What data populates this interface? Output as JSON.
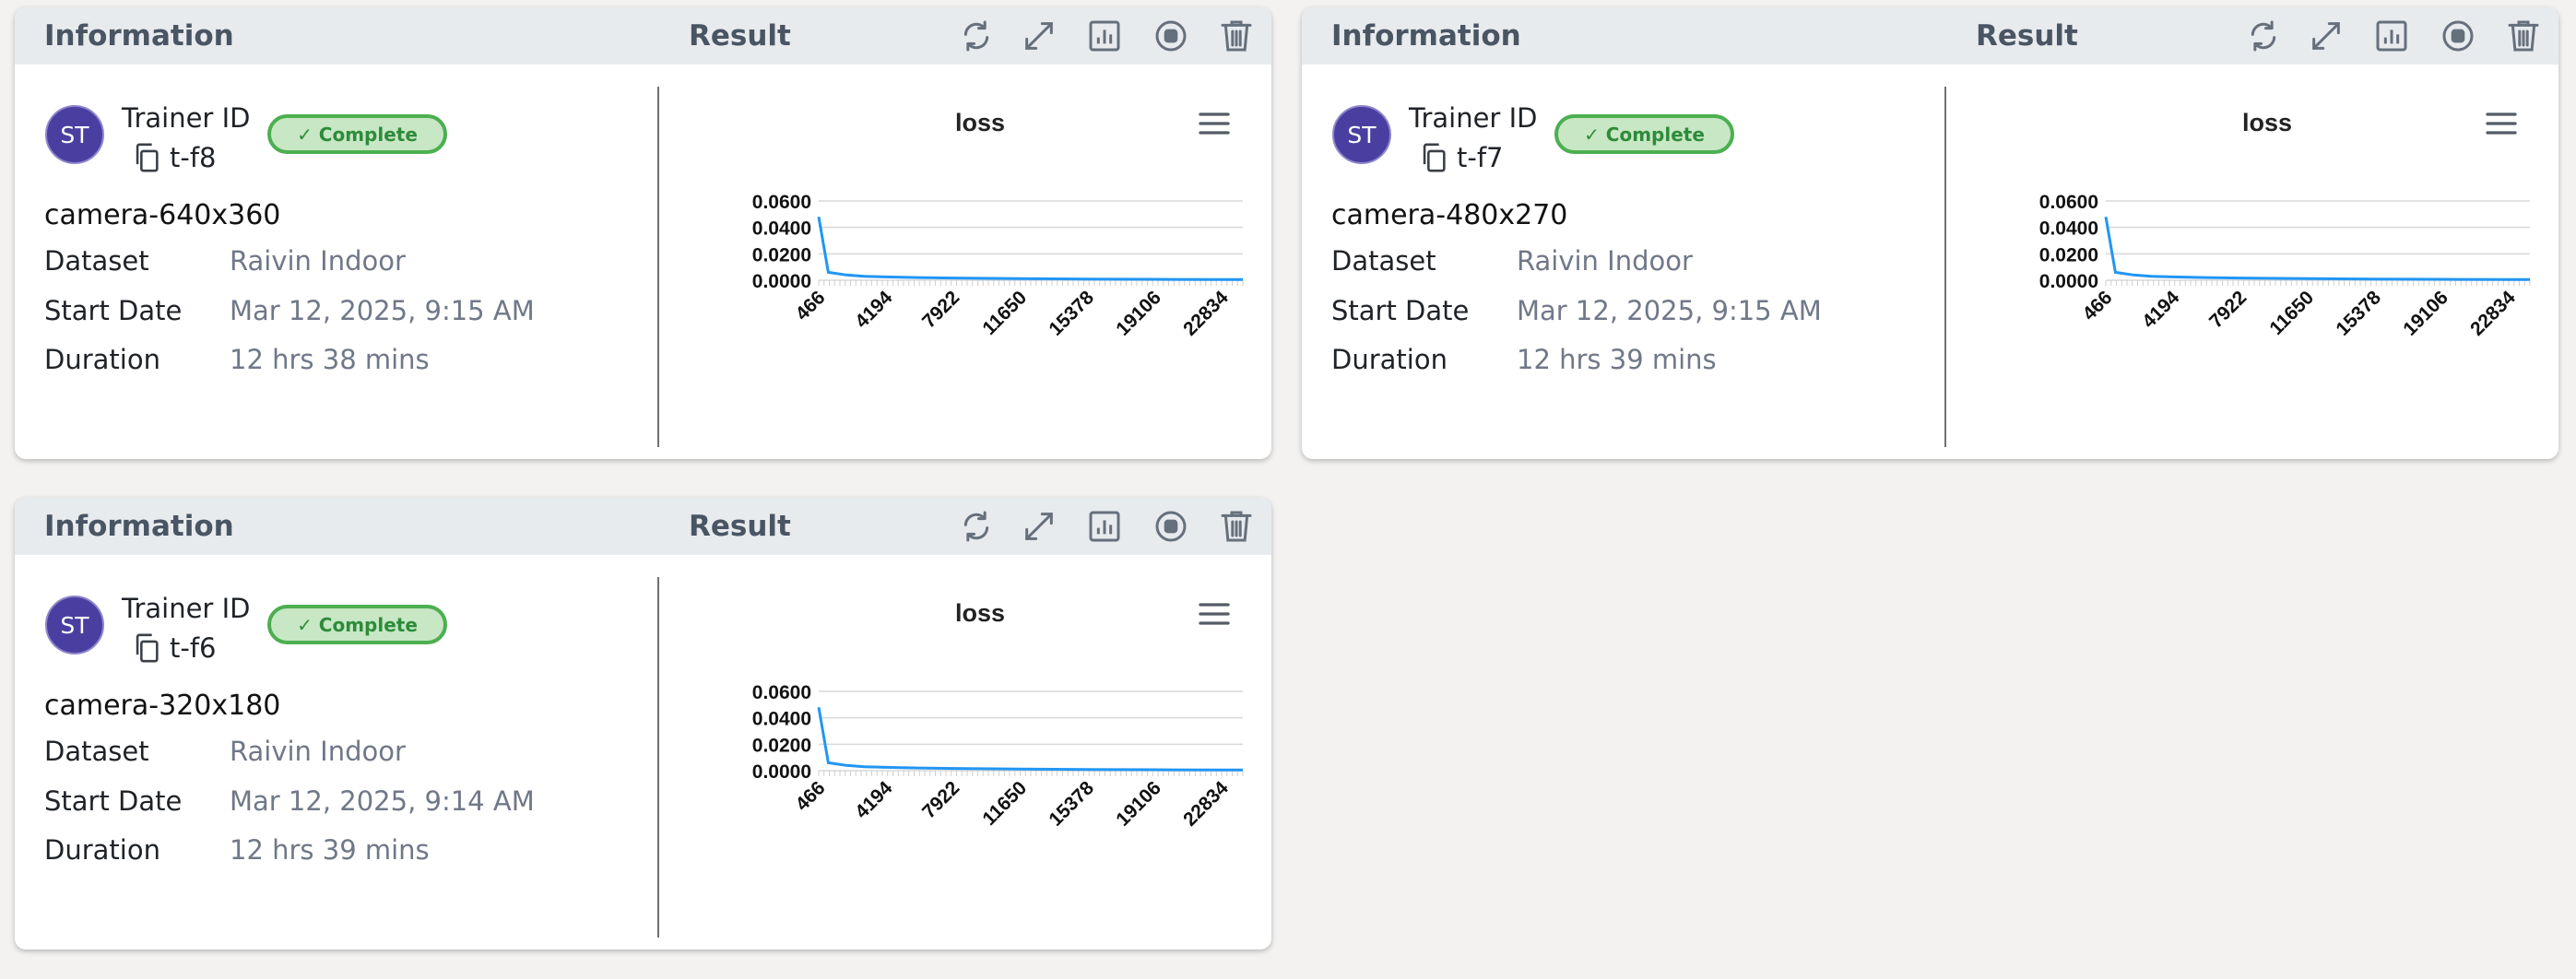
{
  "cards": [
    {
      "header": {
        "info": "Information",
        "result": "Result"
      },
      "avatar": "ST",
      "trainer_label": "Trainer ID",
      "trainer_id": "t-f8",
      "status": "✓ Complete",
      "model": "camera-640x360",
      "rows": [
        {
          "label": "Dataset",
          "value": "Raivin Indoor"
        },
        {
          "label": "Start Date",
          "value": "Mar 12, 2025, 9:15 AM"
        },
        {
          "label": "Duration",
          "value": "12 hrs 38 mins"
        }
      ]
    },
    {
      "header": {
        "info": "Information",
        "result": "Result"
      },
      "avatar": "ST",
      "trainer_label": "Trainer ID",
      "trainer_id": "t-f7",
      "status": "✓ Complete",
      "model": "camera-480x270",
      "rows": [
        {
          "label": "Dataset",
          "value": "Raivin Indoor"
        },
        {
          "label": "Start Date",
          "value": "Mar 12, 2025, 9:15 AM"
        },
        {
          "label": "Duration",
          "value": "12 hrs 39 mins"
        }
      ]
    },
    {
      "header": {
        "info": "Information",
        "result": "Result"
      },
      "avatar": "ST",
      "trainer_label": "Trainer ID",
      "trainer_id": "t-f6",
      "status": "✓ Complete",
      "model": "camera-320x180",
      "rows": [
        {
          "label": "Dataset",
          "value": "Raivin Indoor"
        },
        {
          "label": "Start Date",
          "value": "Mar 12, 2025, 9:14 AM"
        },
        {
          "label": "Duration",
          "value": "12 hrs 39 mins"
        }
      ]
    }
  ],
  "icons": {
    "toolbar": [
      "refresh-icon",
      "expand-icon",
      "chart-icon",
      "stop-icon",
      "delete-icon"
    ],
    "copy": "copy-icon",
    "menu": "menu-icon"
  },
  "colors": {
    "header_bg": "#e8ebee",
    "avatar": "#4a3fa0",
    "badge_border": "#4caf50",
    "badge_bg": "#c7e7c5",
    "line": "#2196f3"
  },
  "chart_data": [
    {
      "type": "line",
      "title": "loss",
      "xlabel": "",
      "ylabel": "",
      "y_ticks": [
        "0.0000",
        "0.0200",
        "0.0400",
        "0.0600"
      ],
      "ylim": [
        0,
        0.06
      ],
      "x_ticks": [
        "466",
        "4194",
        "7922",
        "11650",
        "15378",
        "19106",
        "22834"
      ],
      "xlim": [
        466,
        24000
      ],
      "series": [
        {
          "x": [
            466,
            1000,
            2000,
            3000,
            4194,
            6000,
            7922,
            11650,
            15378,
            19106,
            22834,
            24000
          ],
          "values": [
            0.048,
            0.006,
            0.004,
            0.003,
            0.0025,
            0.002,
            0.0017,
            0.0012,
            0.0009,
            0.0007,
            0.0005,
            0.0005
          ]
        }
      ]
    },
    {
      "type": "line",
      "title": "loss",
      "xlabel": "",
      "ylabel": "",
      "y_ticks": [
        "0.0000",
        "0.0200",
        "0.0400",
        "0.0600"
      ],
      "ylim": [
        0,
        0.06
      ],
      "x_ticks": [
        "466",
        "4194",
        "7922",
        "11650",
        "15378",
        "19106",
        "22834"
      ],
      "xlim": [
        466,
        24000
      ],
      "series": [
        {
          "x": [
            466,
            1000,
            2000,
            3000,
            4194,
            6000,
            7922,
            11650,
            15378,
            19106,
            22834,
            24000
          ],
          "values": [
            0.048,
            0.006,
            0.004,
            0.003,
            0.0025,
            0.002,
            0.0017,
            0.0012,
            0.0009,
            0.0007,
            0.0005,
            0.0005
          ]
        }
      ]
    },
    {
      "type": "line",
      "title": "loss",
      "xlabel": "",
      "ylabel": "",
      "y_ticks": [
        "0.0000",
        "0.0200",
        "0.0400",
        "0.0600"
      ],
      "ylim": [
        0,
        0.06
      ],
      "x_ticks": [
        "466",
        "4194",
        "7922",
        "11650",
        "15378",
        "19106",
        "22834"
      ],
      "xlim": [
        466,
        24000
      ],
      "series": [
        {
          "x": [
            466,
            1000,
            2000,
            3000,
            4194,
            6000,
            7922,
            11650,
            15378,
            19106,
            22834,
            24000
          ],
          "values": [
            0.048,
            0.006,
            0.004,
            0.003,
            0.0025,
            0.002,
            0.0017,
            0.0012,
            0.0009,
            0.0007,
            0.0005,
            0.0005
          ]
        }
      ]
    }
  ]
}
